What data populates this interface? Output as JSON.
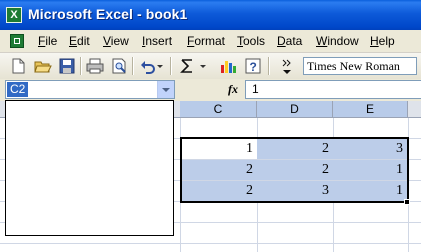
{
  "window": {
    "title": "Microsoft Excel - book1",
    "app_icon_letter": "X"
  },
  "menu": {
    "items": [
      {
        "label": "File"
      },
      {
        "label": "Edit"
      },
      {
        "label": "View"
      },
      {
        "label": "Insert"
      },
      {
        "label": "Format"
      },
      {
        "label": "Tools"
      },
      {
        "label": "Data"
      },
      {
        "label": "Window"
      },
      {
        "label": "Help"
      }
    ]
  },
  "toolbar": {
    "icons": [
      "new-icon",
      "open-icon",
      "save-icon",
      "print-icon",
      "print-preview-icon",
      "undo-icon",
      "autosum-icon",
      "chart-wizard-icon",
      "help-icon",
      "toolbar-options-icon"
    ],
    "font_name": "Times New Roman"
  },
  "formula_bar": {
    "name_box": "C2",
    "fx_label": "fx",
    "formula_value": "1"
  },
  "sheet": {
    "columns": [
      "C",
      "D",
      "E"
    ],
    "rows": [
      [
        "1",
        "2",
        "3"
      ],
      [
        "2",
        "2",
        "1"
      ],
      [
        "2",
        "3",
        "1"
      ]
    ],
    "selection_color": "#bccde9",
    "header_highlight": "#ffc987"
  }
}
